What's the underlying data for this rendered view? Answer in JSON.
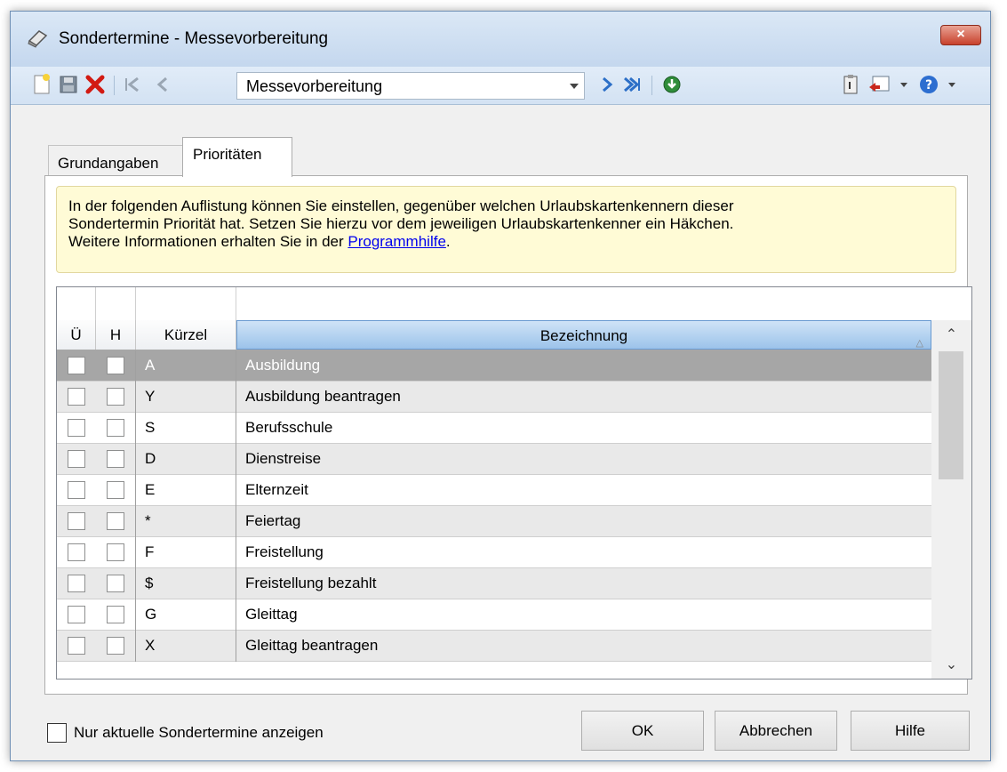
{
  "window": {
    "title": "Sondertermine - Messevorbereitung",
    "close_label": "×"
  },
  "toolbar": {
    "combo_value": "Messevorbereitung",
    "icons": [
      "new-icon",
      "save-icon",
      "delete-icon",
      "first-record-icon",
      "previous-record-icon",
      "next-record-icon",
      "last-record-icon",
      "globe-refresh-icon",
      "clipboard-icon",
      "report-icon",
      "help-icon"
    ]
  },
  "tabs": [
    {
      "label": "Grundangaben"
    },
    {
      "label": "Prioritäten"
    }
  ],
  "info": {
    "line1": "In der folgenden Auflistung können Sie einstellen, gegenüber welchen Urlaubskartenkennern dieser",
    "line2": "Sondertermin Priorität hat. Setzen Sie hierzu vor dem jeweiligen Urlaubskartenkenner ein Häkchen.",
    "line3_prefix": "Weitere Informationen erhalten Sie in der ",
    "link": "Programmhilfe",
    "line3_suffix": "."
  },
  "grid": {
    "columns": {
      "u": "Ü",
      "h": "H",
      "kuerzel": "Kürzel",
      "bezeichnung": "Bezeichnung"
    },
    "sort_indicator": "△",
    "rows": [
      {
        "k": "A",
        "b": "Ausbildung"
      },
      {
        "k": "Y",
        "b": "Ausbildung beantragen"
      },
      {
        "k": "S",
        "b": "Berufsschule"
      },
      {
        "k": "D",
        "b": "Dienstreise"
      },
      {
        "k": "E",
        "b": "Elternzeit"
      },
      {
        "k": "*",
        "b": "Feiertag"
      },
      {
        "k": "F",
        "b": "Freistellung"
      },
      {
        "k": "$",
        "b": "Freistellung bezahlt"
      },
      {
        "k": "G",
        "b": "Gleittag"
      },
      {
        "k": "X",
        "b": "Gleittag beantragen"
      }
    ],
    "scroll_up": "⌃",
    "scroll_down": "⌄"
  },
  "footer": {
    "checkbox_label": "Nur aktuelle Sondertermine anzeigen",
    "ok": "OK",
    "cancel": "Abbrechen",
    "help": "Hilfe"
  }
}
